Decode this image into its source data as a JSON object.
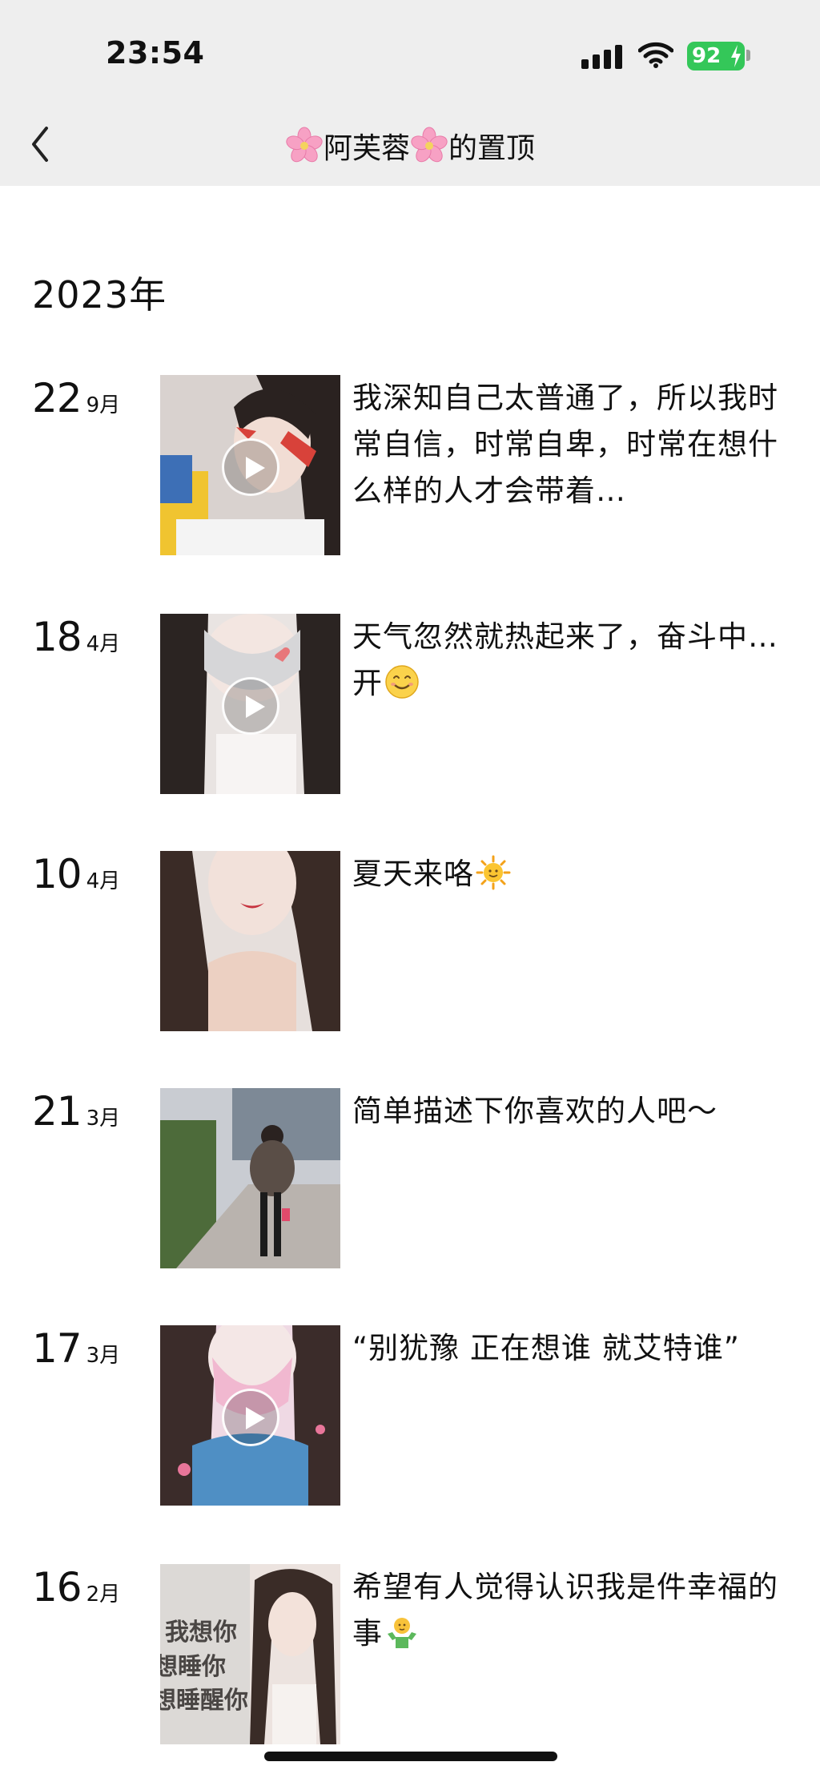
{
  "status_bar": {
    "time": "23:54",
    "battery": "92"
  },
  "header": {
    "title_name": "阿芙蓉",
    "title_suffix": "的置顶"
  },
  "year": "2023年",
  "posts": [
    {
      "day": "22",
      "month": "9月",
      "text": "我深知自己太普通了，所以我时常自信，时常自卑，时常在想什么样的人才会带着…",
      "is_video": true
    },
    {
      "day": "18",
      "month": "4月",
      "text": "天气忽然就热起来了，奋斗中…开",
      "is_video": true
    },
    {
      "day": "10",
      "month": "4月",
      "text": "夏天来咯",
      "is_video": false
    },
    {
      "day": "21",
      "month": "3月",
      "text": "简单描述下你喜欢的人吧～",
      "is_video": false
    },
    {
      "day": "17",
      "month": "3月",
      "text": "“别犹豫 正在想谁 就艾特谁”",
      "is_video": true
    },
    {
      "day": "16",
      "month": "2月",
      "text": "希望有人觉得认识我是件幸福的事",
      "is_video": false,
      "thumb_text": [
        "我想你",
        "想睡你",
        "想睡醒你"
      ]
    }
  ],
  "colors": {
    "header_bg": "#eeeeee",
    "battery": "#34c759",
    "text": "#111111"
  },
  "icons": [
    "back-chevron-icon",
    "cherry-blossom-icon",
    "play-icon",
    "smile-emoji-icon",
    "sun-emoji-icon",
    "shrug-emoji-icon"
  ]
}
